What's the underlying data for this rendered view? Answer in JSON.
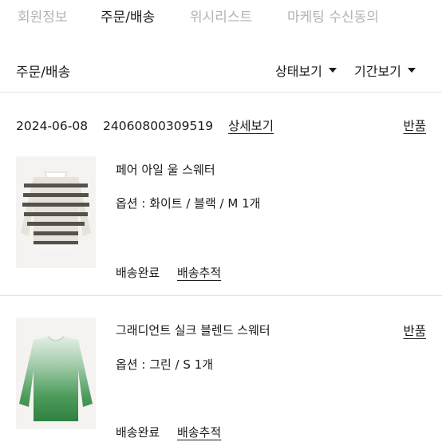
{
  "tabs": [
    {
      "label": "회원정보",
      "active": false
    },
    {
      "label": "주문/배송",
      "active": true
    },
    {
      "label": "위시리스트",
      "active": false
    },
    {
      "label": "마케팅 수신동의",
      "active": false
    }
  ],
  "section": {
    "title": "주문/배송"
  },
  "filters": {
    "status": "상태보기",
    "period": "기간보기"
  },
  "order": {
    "date": "2024-06-08",
    "number": "24060800309519",
    "detail_link": "상세보기",
    "return_label": "반품"
  },
  "items": [
    {
      "name": "페어 아일 울 스웨터",
      "option": "옵션 : 화이트 / 블랙 / M 1개",
      "status": "배송완료",
      "track": "배송추적",
      "return_label": "",
      "image": "striped-wool-sweater"
    },
    {
      "name": "그래디언트 실크 블렌드 스웨터",
      "option": "옵션 : 그린 / S 1개",
      "status": "배송완료",
      "track": "배송추적",
      "return_label": "반품",
      "image": "green-gradient-sweater"
    }
  ],
  "colors": {
    "text": "#1a1a1a",
    "muted": "#b3b3b3",
    "divider": "#e3e3e3"
  }
}
